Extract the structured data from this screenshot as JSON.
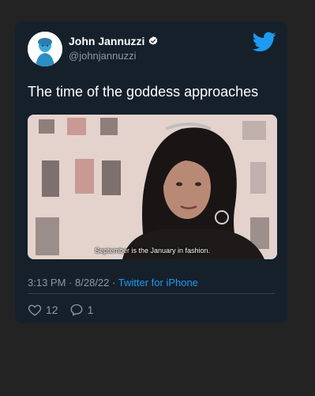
{
  "tweet": {
    "author_name": "John Jannuzzi",
    "handle": "@johnjannuzzi",
    "text": "The time of the goddess approaches",
    "media_subtitle": "September is the January in fashion.",
    "time": "3:13 PM",
    "date": "8/28/22",
    "source": "Twitter for iPhone",
    "separator": "·",
    "likes": "12",
    "replies": "1"
  },
  "colors": {
    "background": "#232323",
    "card": "#15202b",
    "accent": "#1d9bf0"
  },
  "icons": [
    "verified-badge-icon",
    "twitter-bird-icon",
    "heart-icon",
    "reply-icon"
  ]
}
